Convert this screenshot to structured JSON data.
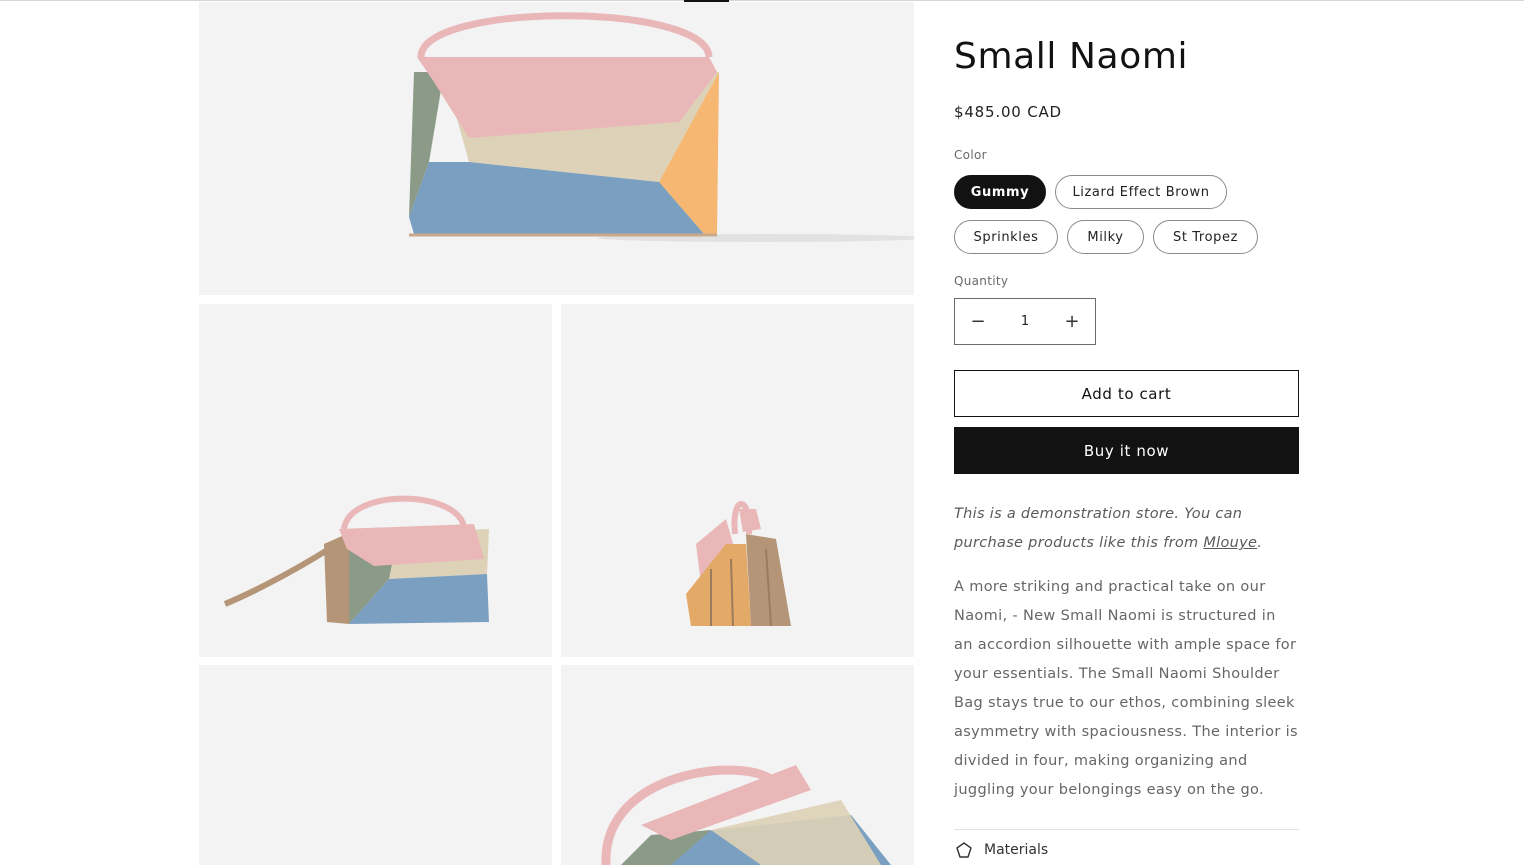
{
  "product": {
    "title": "Small Naomi",
    "price": "$485.00 CAD"
  },
  "color": {
    "label": "Color",
    "options": [
      "Gummy",
      "Lizard Effect Brown",
      "Sprinkles",
      "Milky",
      "St Tropez"
    ],
    "selected": "Gummy"
  },
  "quantity": {
    "label": "Quantity",
    "value": "1",
    "decrement_icon": "minus-icon",
    "increment_icon": "plus-icon"
  },
  "buttons": {
    "add_to_cart": "Add to cart",
    "buy_now": "Buy it now"
  },
  "demo_note": {
    "text": "This is a demonstration store. You can purchase products like this from ",
    "link": "Mlouye",
    "end": "."
  },
  "description": "A more striking and practical take on our Naomi, - New Small Naomi is structured in an accordion silhouette with ample space for your essentials. The Small Naomi Shoulder Bag stays true to our ethos, combining sleek asymmetry with spaciousness. The interior is divided in four, making organizing and juggling your belongings easy on the go.",
  "accordion": {
    "icon": "material-icon",
    "label": "Materials"
  },
  "colors": {
    "pink": "#eab7b9",
    "sage": "#8c9a88",
    "sand": "#ddd1b7",
    "blue": "#7a9fc0",
    "orange": "#f5b771",
    "tan": "#b59577",
    "tile_bg": "#f3f3f3"
  }
}
